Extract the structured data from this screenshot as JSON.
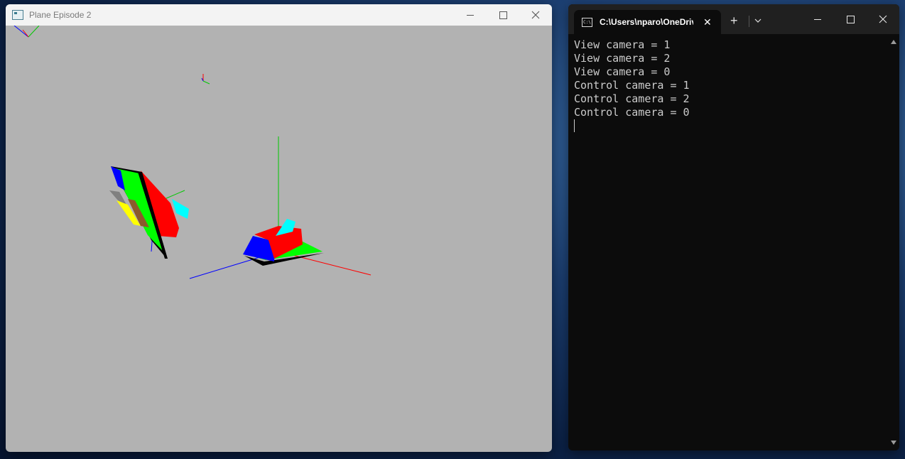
{
  "gl_window": {
    "title": "Plane Episode 2",
    "minimize_icon": "minimize-icon",
    "maximize_icon": "maximize-icon",
    "close_icon": "close-icon",
    "background": "#b2b2b2",
    "axis_colors": {
      "x": "#ff0000",
      "y": "#00c800",
      "z": "#0000ff"
    },
    "plane_colors": [
      "#ff0000",
      "#00ff00",
      "#0000ff",
      "#00ffff",
      "#ffff00",
      "#8b5a2b",
      "#808080",
      "#000000"
    ]
  },
  "terminal": {
    "tab_title": "C:\\Users\\nparo\\OneDriv",
    "tab_icon": "cmd-icon",
    "add_tab_label": "+",
    "lines": [
      "View camera = 1",
      "View camera = 2",
      "View camera = 0",
      "Control camera = 1",
      "Control camera = 2",
      "Control camera = 0"
    ],
    "background": "#0c0c0c",
    "text_color": "#cccccc"
  }
}
